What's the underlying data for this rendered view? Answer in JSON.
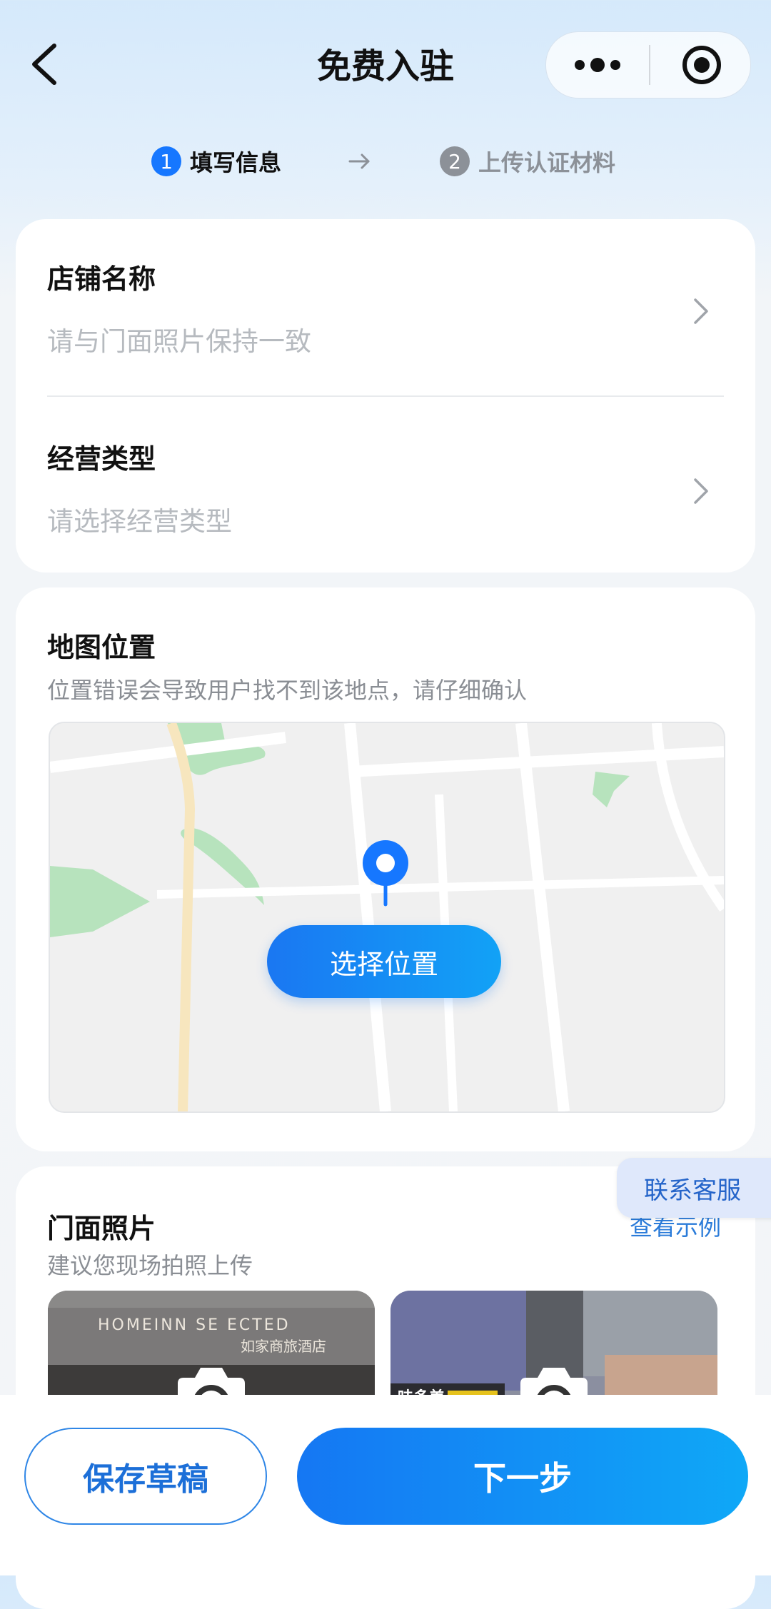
{
  "header": {
    "title": "免费入驻"
  },
  "steps": [
    {
      "num": "1",
      "label": "填写信息"
    },
    {
      "num": "2",
      "label": "上传认证材料"
    }
  ],
  "form": {
    "store_name": {
      "label": "店铺名称",
      "placeholder": "请与门面照片保持一致"
    },
    "business_type": {
      "label": "经营类型",
      "placeholder": "请选择经营类型"
    }
  },
  "map_section": {
    "label": "地图位置",
    "hint": "位置错误会导致用户找不到该地点，请仔细确认",
    "select_button": "选择位置"
  },
  "photo_section": {
    "label": "门面照片",
    "hint": "建议您现场拍照上传",
    "example_link": "查看示例",
    "photo1_sign": "HOMEINN SE  ECTED",
    "photo1_sign_cn": "如家商旅酒店",
    "photo2_sign": "味多美"
  },
  "float": {
    "service_label": "联系客服"
  },
  "footer": {
    "save_label": "保存草稿",
    "next_label": "下一步"
  },
  "colors": {
    "primary": "#1677ff",
    "step_inactive": "#8c9198"
  }
}
